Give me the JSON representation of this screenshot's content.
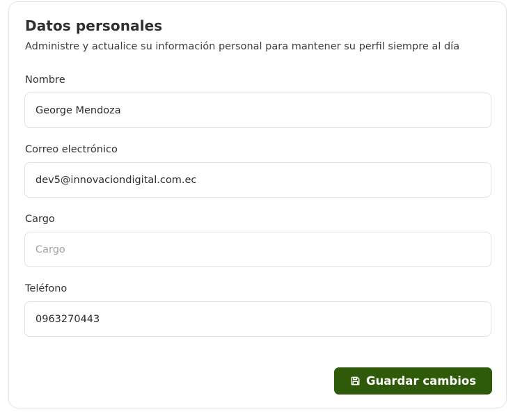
{
  "section": {
    "title": "Datos personales",
    "subtitle": "Administre y actualice su información personal para mantener su perfil siempre al día"
  },
  "fields": [
    {
      "label": "Nombre",
      "value": "George Mendoza",
      "placeholder": ""
    },
    {
      "label": "Correo electrónico",
      "value": "dev5@innovaciondigital.com.ec",
      "placeholder": ""
    },
    {
      "label": "Cargo",
      "value": "",
      "placeholder": "Cargo"
    },
    {
      "label": "Teléfono",
      "value": "0963270443",
      "placeholder": ""
    }
  ],
  "actions": {
    "save_label": "Guardar cambios",
    "save_icon": "save-icon"
  },
  "colors": {
    "primary": "#2e5a0a",
    "border": "#e0e0e0",
    "text": "#2f2f2f",
    "placeholder": "#a3a3a3"
  }
}
